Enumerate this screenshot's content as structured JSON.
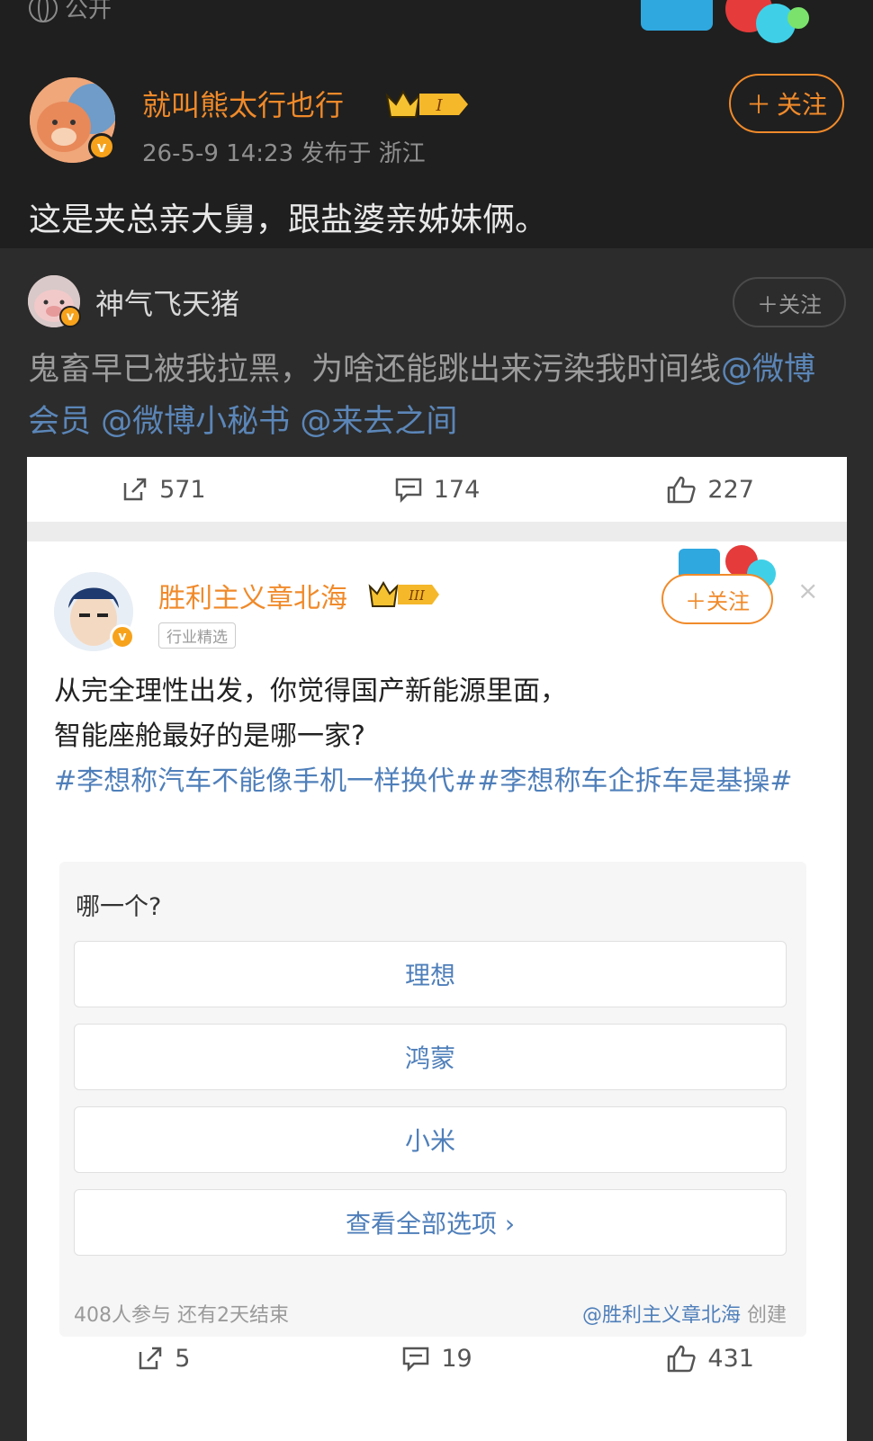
{
  "top": {
    "visibility": "公开"
  },
  "post": {
    "author": "就叫熊太行也行",
    "badge_level": "I",
    "time_location": "26-5-9 14:23  发布于 浙江",
    "follow_label": "关注",
    "text": "这是夹总亲大舅，跟盐婆亲姊妹俩。"
  },
  "repost": {
    "author": "神气飞天猪",
    "follow_label": "关注",
    "text": "鬼畜早已被我拉黑，为啥还能跳出来污染我时间线",
    "mentions": [
      "@微博会员",
      "@微博小秘书",
      "@来去之间"
    ]
  },
  "embedded": {
    "stats_top": {
      "reposts": "571",
      "comments": "174",
      "likes": "227"
    },
    "author": "胜利主义章北海",
    "badge_level": "III",
    "tag": "行业精选",
    "follow_label": "关注",
    "close": "×",
    "text_line1": "从完全理性出发，你觉得国产新能源里面，",
    "text_line2": "智能座舱最好的是哪一家?",
    "topics": "#李想称汽车不能像手机一样换代##李想称车企拆车是基操#",
    "poll": {
      "question": "哪一个?",
      "options": [
        "理想",
        "鸿蒙",
        "小米"
      ],
      "view_all": "查看全部选项 ›",
      "participants": "408人参与   还有2天结束",
      "creator": "@胜利主义章北海",
      "created": "创建"
    },
    "stats_bottom": {
      "reposts": "5",
      "comments": "19",
      "likes": "431"
    }
  },
  "colors": {
    "brand_orange": "#f08a2a",
    "link_blue": "#4f7fba",
    "bg_dark": "#1f1f1f"
  }
}
